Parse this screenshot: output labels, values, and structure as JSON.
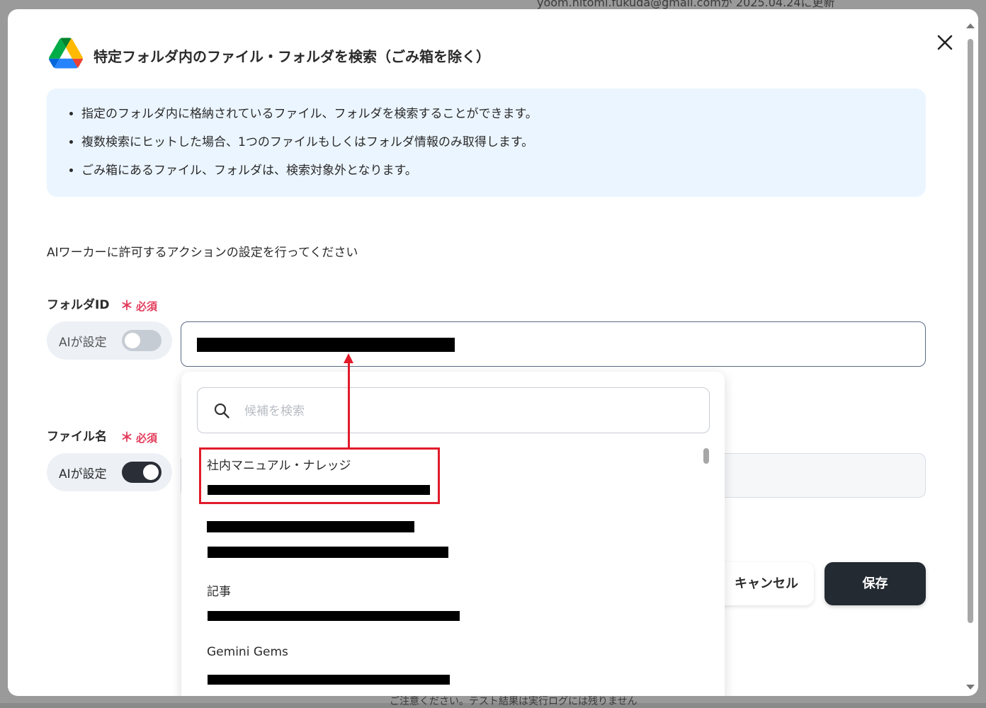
{
  "background": {
    "top_text": "yoom.hitomi.fukuda@gmail.comが 2025.04.24に更新",
    "bottom_text": "ご注意ください。テスト結果は実行ログには残りません"
  },
  "modal": {
    "title": "特定フォルダ内のファイル・フォルダを検索（ごみ箱を除く）",
    "close_icon": "close-icon",
    "app_icon": "google-drive-icon",
    "info_items": [
      "指定のフォルダ内に格納されているファイル、フォルダを検索することができます。",
      "複数検索にヒットした場合、1つのファイルもしくはフォルダ情報のみ取得します。",
      "ごみ箱にあるファイル、フォルダは、検索対象外となります。"
    ],
    "instruction": "AIワーカーに許可するアクションの設定を行ってください",
    "folder_field": {
      "label": "フォルダID",
      "required": "必須",
      "ai_toggle_label": "AIが設定",
      "ai_toggle_on": false
    },
    "file_field": {
      "label": "ファイル名",
      "required": "必須",
      "ai_toggle_label": "AIが設定",
      "ai_toggle_on": true
    },
    "buttons": {
      "cancel": "キャンセル",
      "save": "保存"
    }
  },
  "dropdown": {
    "search_placeholder": "候補を検索",
    "items": [
      {
        "title": "社内マニュアル・ナレッジ",
        "highlighted": true
      },
      {
        "title": ""
      },
      {
        "title": "記事"
      },
      {
        "title": "Gemini Gems"
      }
    ]
  },
  "colors": {
    "accent_red": "#e11b2a",
    "required_red": "#e23b5a",
    "primary_dark": "#242a32",
    "info_bg": "#ebf5ff"
  }
}
